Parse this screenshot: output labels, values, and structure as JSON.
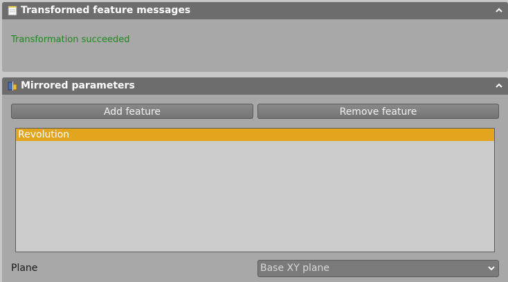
{
  "messages_panel": {
    "title": "Transformed feature messages",
    "message": "Transformation succeeded",
    "icon": "note-icon"
  },
  "params_panel": {
    "title": "Mirrored parameters",
    "icon": "mirror-params-icon",
    "add_label": "Add feature",
    "remove_label": "Remove feature",
    "features": [
      "Revolution"
    ],
    "plane_label": "Plane",
    "plane_value": "Base XY plane"
  },
  "colors": {
    "accent": "#e3a51e",
    "success": "#1c8a1c",
    "header": "#6d6d6d"
  }
}
